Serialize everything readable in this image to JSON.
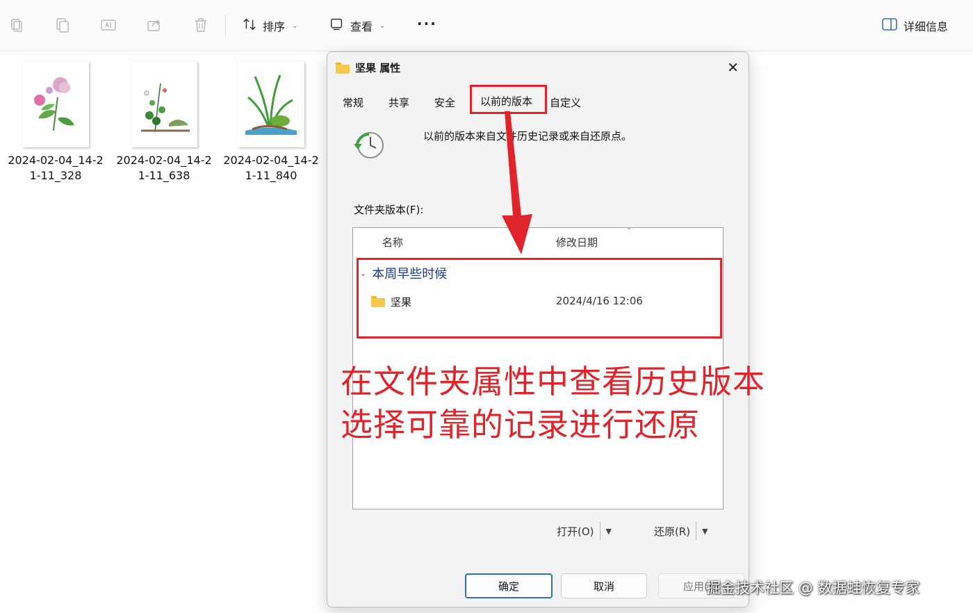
{
  "toolbar": {
    "sort_label": "排序",
    "view_label": "查看",
    "more_label": "···",
    "details_label": "详细信息"
  },
  "files": [
    {
      "name": "2024-02-04_14-21-11_328"
    },
    {
      "name": "2024-02-04_14-21-11_638"
    },
    {
      "name": "2024-02-04_14-21-11_840"
    }
  ],
  "dialog": {
    "title": "坚果 属性",
    "close": "✕",
    "tabs": [
      "常规",
      "共享",
      "安全",
      "以前的版本",
      "自定义"
    ],
    "active_tab": "以前的版本",
    "info_text": "以前的版本来自文件历史记录或来自还原点。",
    "folder_versions_label": "文件夹版本(F):",
    "columns": {
      "name": "名称",
      "date": "修改日期"
    },
    "group_label": "本周早些时候",
    "rows": [
      {
        "name": "坚果",
        "date": "2024/4/16 12:06"
      }
    ],
    "open_label": "打开(O)",
    "restore_label": "还原(R)",
    "ok_label": "确定",
    "cancel_label": "取消",
    "apply_label": "应用(A)"
  },
  "annotation": {
    "line1": "在文件夹属性中查看历史版本",
    "line2": "选择可靠的记录进行还原"
  },
  "watermark": "掘金技术社区 @ 数据蛙恢复专家",
  "colors": {
    "highlight": "#e0242b",
    "accent": "#2f6fc2"
  }
}
